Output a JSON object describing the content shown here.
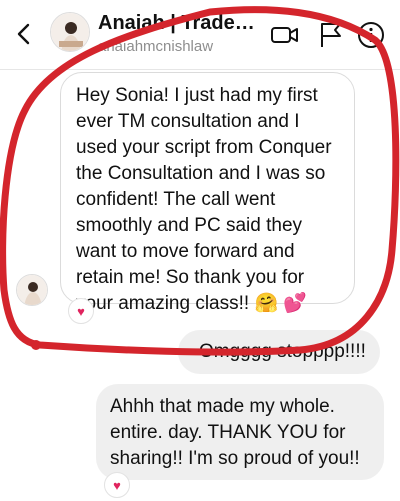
{
  "header": {
    "title": "Anaiah | Tradem...",
    "username": "anaiahmcnishlaw"
  },
  "messages": [
    {
      "direction": "incoming",
      "text": "Hey Sonia! I just had my first ever TM consultation and I used your script from Conquer the Consultation and I was so confident! The call went smoothly and PC said they want to move forward and retain me! So thank you for your amazing class!! 🤗 💕",
      "reaction": "♥"
    },
    {
      "direction": "outgoing",
      "text": "Omgggg stopppp!!!!"
    },
    {
      "direction": "outgoing",
      "text": "Ahhh that made my whole. entire. day. THANK YOU for sharing!! I'm so proud of you!!",
      "reaction": "♥"
    }
  ],
  "colors": {
    "annotation_red": "#d4252c",
    "reaction_heart": "#e0245e",
    "outgoing_bubble": "#efefef",
    "incoming_border": "#dbdbdb"
  },
  "icons": [
    "back-chevron-icon",
    "video-call-icon",
    "flag-icon",
    "info-icon",
    "heart-reaction-icon"
  ]
}
